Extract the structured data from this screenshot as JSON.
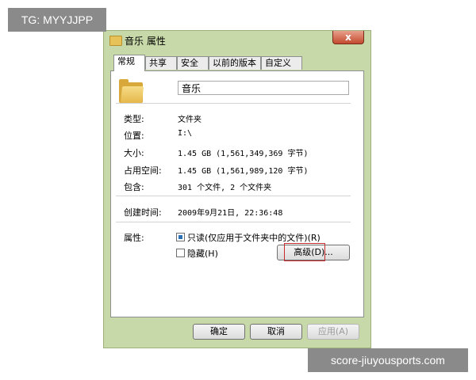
{
  "watermarks": {
    "top_left": "TG: MYYJJPP",
    "bottom_right": "score-jiuyousports.com"
  },
  "window": {
    "title": "音乐 属性",
    "close_glyph": "x"
  },
  "tabs": [
    {
      "label": "常规",
      "active": true
    },
    {
      "label": "共享",
      "active": false
    },
    {
      "label": "安全",
      "active": false
    },
    {
      "label": "以前的版本",
      "active": false
    },
    {
      "label": "自定义",
      "active": false
    }
  ],
  "general": {
    "folder_name": "音乐",
    "rows": [
      {
        "label": "类型:",
        "value": "文件夹"
      },
      {
        "label": "位置:",
        "value": "I:\\"
      },
      {
        "label": "大小:",
        "value": "1.45 GB (1,561,349,369 字节)"
      },
      {
        "label": "占用空间:",
        "value": "1.45 GB (1,561,989,120 字节)"
      },
      {
        "label": "包含:",
        "value": "301 个文件, 2 个文件夹"
      },
      {
        "label": "创建时间:",
        "value": "2009年9月21日, 22:36:48"
      }
    ],
    "attributes_label": "属性:",
    "readonly": {
      "label": "只读(仅应用于文件夹中的文件)(R)",
      "checked": true
    },
    "hidden": {
      "label": "隐藏(H)",
      "checked": false
    },
    "advanced_label": "高级(D)..."
  },
  "buttons": {
    "ok": "确定",
    "cancel": "取消",
    "apply": "应用(A)"
  },
  "colors": {
    "window_frame": "#c7d9a8",
    "close_button": "#c24b2e",
    "checkbox_fill": "#2b6fb5",
    "highlight_box": "#c62b2b"
  }
}
